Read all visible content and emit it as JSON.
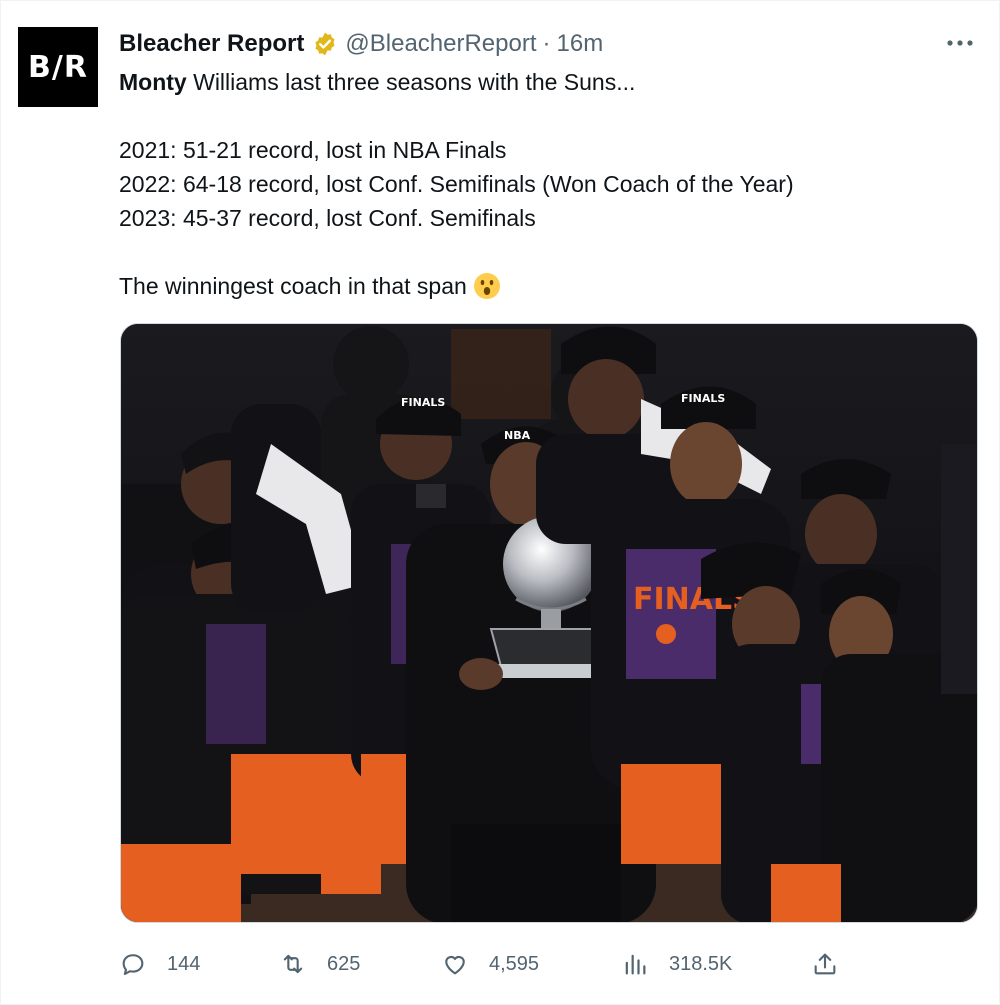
{
  "tweet": {
    "avatar_text": "B/R",
    "author_name": "Bleacher Report",
    "handle": "@BleacherReport",
    "separator": "·",
    "time": "16m",
    "lines": {
      "intro_bold": "Monty",
      "intro_rest": " Williams last three seasons with the Suns...",
      "s2021": "2021: 51-21 record, lost in NBA Finals",
      "s2022": "2022: 64-18 record, lost Conf. Semifinals (Won Coach of the Year)",
      "s2023": "2023: 45-37 record, lost Conf. Semifinals",
      "closing": "The winningest coach in that span"
    },
    "emoji": "astonished-face-emoji",
    "media": {
      "hat_text_top": "NBA",
      "hat_text_bottom": "FINALS",
      "shirt_text": "FINALS"
    },
    "actions": {
      "replies": "144",
      "retweets": "625",
      "likes": "4,595",
      "views": "318.5K"
    }
  },
  "colors": {
    "text": "#0f1419",
    "secondary": "#536471",
    "verified_gold": "#e2b719",
    "suns_orange": "#e56020",
    "suns_purple": "#5a2d81"
  },
  "icons": [
    "verified-icon",
    "more-icon",
    "reply-icon",
    "retweet-icon",
    "like-icon",
    "views-icon",
    "share-icon"
  ]
}
